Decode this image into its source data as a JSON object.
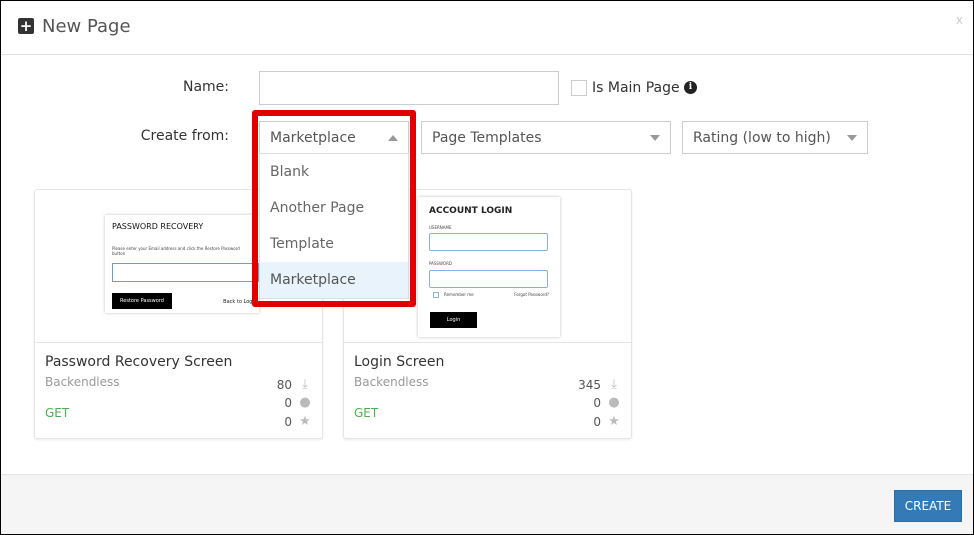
{
  "header": {
    "title": "New Page",
    "close": "x"
  },
  "form": {
    "name_label": "Name:",
    "name_value": "",
    "is_main_label": "Is Main Page",
    "create_from_label": "Create from:",
    "create_from_value": "Marketplace",
    "category_value": "Page Templates",
    "sort_value": "Rating (low to high)",
    "options": [
      "Blank",
      "Another Page",
      "Template",
      "Marketplace"
    ]
  },
  "cards": [
    {
      "title": "Password Recovery Screen",
      "author": "Backendless",
      "get": "GET",
      "downloads": "80",
      "comments": "0",
      "stars": "0",
      "thumb": {
        "heading": "PASSWORD RECOVERY",
        "text": "Please enter your Email address and click the Restore Password button",
        "button": "Restore Password",
        "link": "Back to Login"
      }
    },
    {
      "title": "Login Screen",
      "author": "Backendless",
      "get": "GET",
      "downloads": "345",
      "comments": "0",
      "stars": "0",
      "thumb": {
        "heading": "ACCOUNT LOGIN",
        "username": "USERNAME",
        "password": "PASSWORD",
        "remember": "Remember me",
        "forgot": "Forgot Password?",
        "button": "Login"
      }
    }
  ],
  "footer": {
    "create": "CREATE"
  },
  "colors": {
    "accent": "#337ab7",
    "highlight": "#e00000",
    "get": "#4caf50"
  }
}
